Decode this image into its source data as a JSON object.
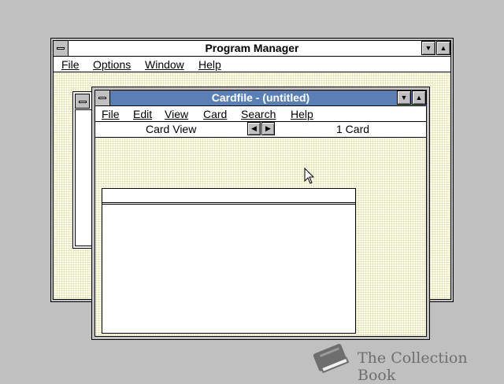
{
  "program_manager": {
    "title": "Program Manager",
    "menu": [
      "File",
      "Options",
      "Window",
      "Help"
    ]
  },
  "cardfile": {
    "title": "Cardfile - (untitled)",
    "menu": [
      "File",
      "Edit",
      "View",
      "Card",
      "Search",
      "Help"
    ],
    "status": {
      "view": "Card View",
      "count": "1 Card"
    }
  },
  "watermark": {
    "text": "The Collection Book"
  },
  "colors": {
    "desktop": "#c0c0c0",
    "active_title": "#5a7fb4",
    "workspace": "#ffffe6"
  }
}
